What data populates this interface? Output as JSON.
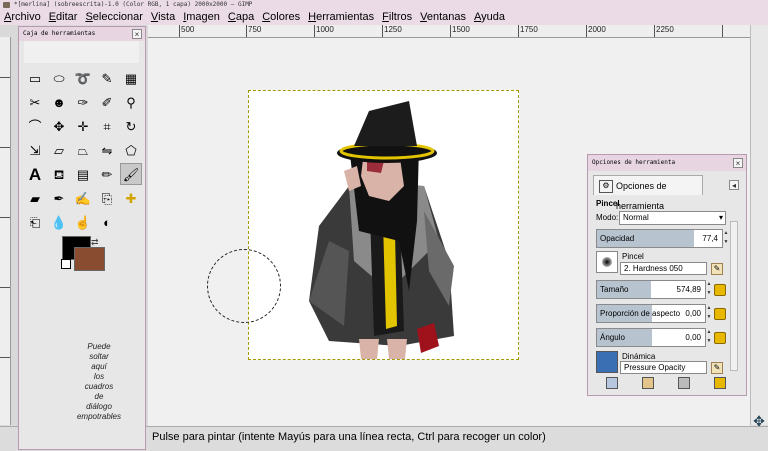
{
  "window": {
    "title": "*[merlina] (sobreescrita)-1.0 (Color RGB, 1 capa) 2000x2000 – GIMP"
  },
  "menu": [
    "Archivo",
    "Editar",
    "Seleccionar",
    "Vista",
    "Imagen",
    "Capa",
    "Colores",
    "Herramientas",
    "Filtros",
    "Ventanas",
    "Ayuda"
  ],
  "ruler": {
    "labels": [
      "500",
      "750",
      "1000",
      "1250",
      "1500",
      "1750",
      "2000",
      "2250"
    ]
  },
  "toolbox": {
    "title": "Caja de herramientas",
    "drop_hint": [
      "Puede",
      "soltar",
      "aquí",
      "los",
      "cuadros",
      "de",
      "diálogo",
      "empotrables"
    ],
    "tools": [
      "rect-select-icon",
      "ellipse-select-icon",
      "free-select-icon",
      "fuzzy-select-icon",
      "color-select-icon",
      "scissors-icon",
      "foreground-select-icon",
      "paths-icon",
      "color-picker-icon",
      "zoom-icon",
      "measure-icon",
      "move-icon",
      "align-icon",
      "crop-icon",
      "rotate-icon",
      "scale-icon",
      "shear-icon",
      "perspective-icon",
      "flip-icon",
      "cage-icon",
      "text-icon",
      "bucket-fill-icon",
      "blend-icon",
      "pencil-icon",
      "paintbrush-icon",
      "eraser-icon",
      "airbrush-icon",
      "ink-icon",
      "clone-icon",
      "heal-icon",
      "perspective-clone-icon",
      "blur-icon",
      "smudge-icon",
      "dodge-icon"
    ],
    "fg_color": "#000000",
    "bg_color": "#8a4c30"
  },
  "status": {
    "text": "Pulse para pintar (intente Mayús para una línea recta, Ctrl para recoger un color)"
  },
  "tool_options": {
    "title": "Opciones de herramienta",
    "tab_label": "Opciones de herramienta",
    "section": "Pincel",
    "mode_label": "Modo:",
    "mode_value": "Normal",
    "opacity_label": "Opacidad",
    "opacity_value": "77,4",
    "opacity_level": 0.774,
    "brush_label": "Pincel",
    "brush_value": "2. Hardness 050",
    "size_label": "Tamaño",
    "size_value": "574,89",
    "size_level": 0.5,
    "aspect_label": "Proporción de aspecto",
    "aspect_value": "0,00",
    "angle_label": "Ángulo",
    "angle_value": "0,00",
    "dynamics_label": "Dinámica",
    "dynamics_value": "Pressure Opacity"
  }
}
